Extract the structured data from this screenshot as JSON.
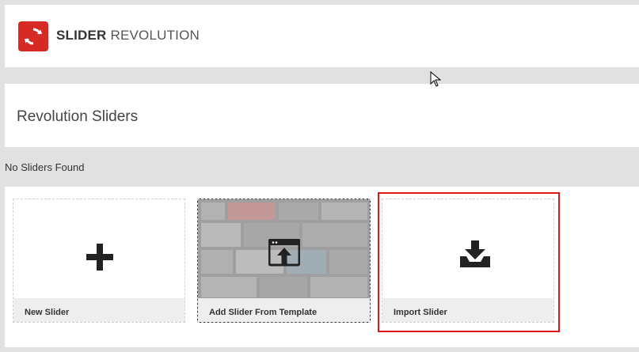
{
  "header": {
    "brand_bold": "SLIDER",
    "brand_light": "REVOLUTION",
    "logo_icon": "refresh-icon",
    "brand_color": "#d62b25"
  },
  "page": {
    "title": "Revolution Sliders",
    "status": "No Sliders Found"
  },
  "cards": {
    "new_slider": {
      "label": "New Slider",
      "icon": "plus-icon"
    },
    "from_template": {
      "label": "Add Slider From Template",
      "icon": "template-upload-icon"
    },
    "import_slider": {
      "label": "Import Slider",
      "icon": "import-download-icon"
    }
  },
  "highlight_color": "#e01515"
}
